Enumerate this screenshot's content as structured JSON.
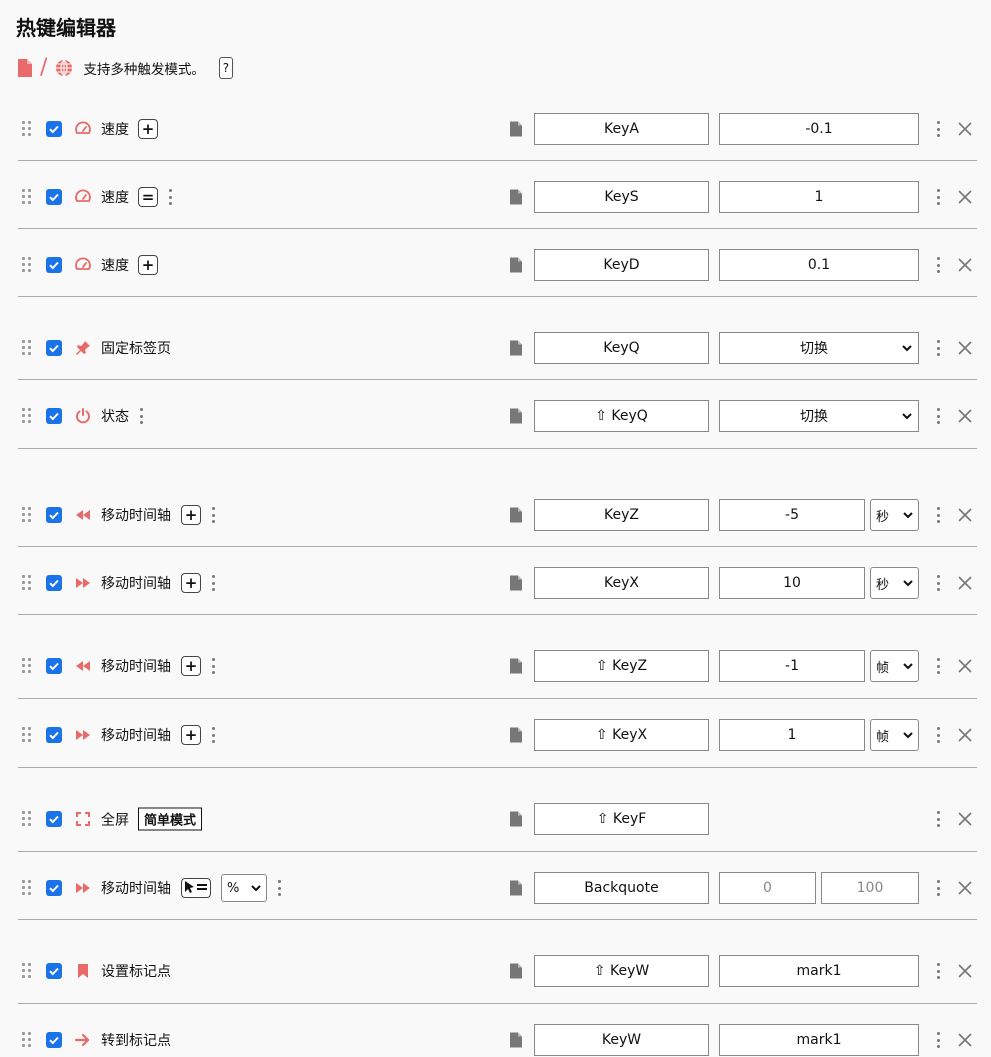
{
  "title": "热键编辑器",
  "subtitle": {
    "text": "支持多种触发模式。",
    "slash": "/",
    "help_label": "?"
  },
  "colors": {
    "accent": "#e86a6a",
    "checkbox": "#1a73e8",
    "separator": "#aaaaaa",
    "background": "#f9f9f9"
  },
  "rows": [
    {
      "icon": "speedometer-icon",
      "label": "速度",
      "mode_button": "+",
      "kebab": false,
      "hotkey": "KeyA",
      "value": "-0.1"
    },
    {
      "icon": "speedometer-icon",
      "label": "速度",
      "mode_button": "=",
      "kebab": true,
      "hotkey": "KeyS",
      "value": "1"
    },
    {
      "icon": "speedometer-icon",
      "label": "速度",
      "mode_button": "+",
      "kebab": false,
      "hotkey": "KeyD",
      "value": "0.1"
    },
    {
      "icon": "pin-icon",
      "label": "固定标签页",
      "hotkey": "KeyQ",
      "select": "切换"
    },
    {
      "icon": "power-icon",
      "label": "状态",
      "kebab": true,
      "hotkey": "⇧ KeyQ",
      "select": "切换"
    },
    {
      "icon": "rewind-icon",
      "label": "移动时间轴",
      "mode_button": "+",
      "kebab": true,
      "hotkey": "KeyZ",
      "value": "-5",
      "unit": "秒"
    },
    {
      "icon": "fast-forward-icon",
      "label": "移动时间轴",
      "mode_button": "+",
      "kebab": true,
      "hotkey": "KeyX",
      "value": "10",
      "unit": "秒"
    },
    {
      "icon": "rewind-icon",
      "label": "移动时间轴",
      "mode_button": "+",
      "kebab": true,
      "hotkey": "⇧ KeyZ",
      "value": "-1",
      "unit": "帧"
    },
    {
      "icon": "fast-forward-icon",
      "label": "移动时间轴",
      "mode_button": "+",
      "kebab": true,
      "hotkey": "⇧ KeyX",
      "value": "1",
      "unit": "帧"
    },
    {
      "icon": "fullscreen-icon",
      "label": "全屏",
      "simple_mode": "简单模式",
      "hotkey": "⇧ KeyF"
    },
    {
      "icon": "fast-forward-icon",
      "label": "移动时间轴",
      "pointer_mode": true,
      "percent_select": "%",
      "kebab": true,
      "hotkey": "Backquote",
      "range_min": "0",
      "range_max": "100"
    },
    {
      "icon": "bookmark-icon",
      "label": "设置标记点",
      "hotkey": "⇧ KeyW",
      "value": "mark1"
    },
    {
      "icon": "arrow-right-icon",
      "label": "转到标记点",
      "hotkey": "KeyW",
      "value": "mark1"
    }
  ]
}
